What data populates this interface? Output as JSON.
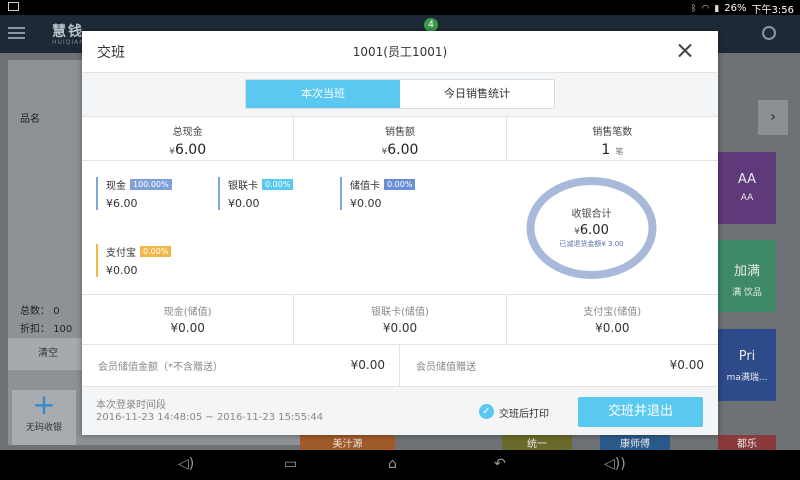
{
  "status_bar": {
    "time": "下午3:56",
    "battery": "26%"
  },
  "background_app": {
    "logo": "慧钱",
    "logo_sub": "HUIQIAN",
    "notification_count": "4",
    "left_panel": {
      "col_name": "品名",
      "total_label": "总数：",
      "total_value": "0",
      "discount_label": "折扣：",
      "discount_value": "100",
      "clear_label": "清空",
      "add_label": "无码收银"
    },
    "tiles": [
      {
        "text": "AA",
        "sub": "AA",
        "color": "#5e3a7a"
      },
      {
        "text": "加满",
        "sub": "满 饮品",
        "color": "#3f8a66"
      },
      {
        "text": "Pri",
        "sub": "ma满瑞...",
        "color": "#2d4a8a"
      },
      {
        "text": "美汁源",
        "color": "#a05a2a"
      },
      {
        "text": "统一",
        "color": "#6a6a2a"
      },
      {
        "text": "康师傅",
        "color": "#2a5a8a"
      },
      {
        "text": "都乐",
        "color": "#8a3a3a"
      }
    ],
    "nav_right": "›"
  },
  "modal": {
    "title": "交班",
    "user": "1001(员工1001)",
    "tabs": [
      {
        "label": "本次当班",
        "active": true
      },
      {
        "label": "今日销售统计",
        "active": false
      }
    ],
    "summary": [
      {
        "label": "总现金",
        "currency": "¥",
        "value": "6.00",
        "unit": ""
      },
      {
        "label": "销售额",
        "currency": "¥",
        "value": "6.00",
        "unit": ""
      },
      {
        "label": "销售笔数",
        "currency": "",
        "value": "1",
        "unit": "笔"
      }
    ],
    "payments": [
      {
        "name": "现金",
        "percent": "100.00%",
        "value": "¥6.00",
        "tag_color": "#7fa0d8"
      },
      {
        "name": "银联卡",
        "percent": "0.00%",
        "value": "¥0.00",
        "tag_color": "#5ac8f0"
      },
      {
        "name": "储值卡",
        "percent": "0.00%",
        "value": "¥0.00",
        "tag_color": "#6a8fd8"
      },
      {
        "name": "支付宝",
        "percent": "0.00%",
        "value": "¥0.00",
        "tag_color": "#f0b84a"
      }
    ],
    "ring": {
      "title": "收银合计",
      "currency": "¥",
      "total": "6.00",
      "note": "已减退货金额¥ 3.00",
      "color": "#a9b9d9"
    },
    "stored_value": [
      {
        "label": "现金(储值)",
        "value": "¥0.00"
      },
      {
        "label": "银联卡(储值)",
        "value": "¥0.00"
      },
      {
        "label": "支付宝(储值)",
        "value": "¥0.00"
      }
    ],
    "member": [
      {
        "label": "会员储值金额（*不含赠送）",
        "value": "¥0.00"
      },
      {
        "label": "会员储值赠送",
        "value": "¥0.00"
      }
    ],
    "footer": {
      "period_label": "本次登录时间段",
      "period_range": "2016-11-23 14:48:05 ~ 2016-11-23 15:55:44",
      "print_label": "交班后打印",
      "print_checked": true,
      "submit_label": "交班并退出"
    }
  }
}
